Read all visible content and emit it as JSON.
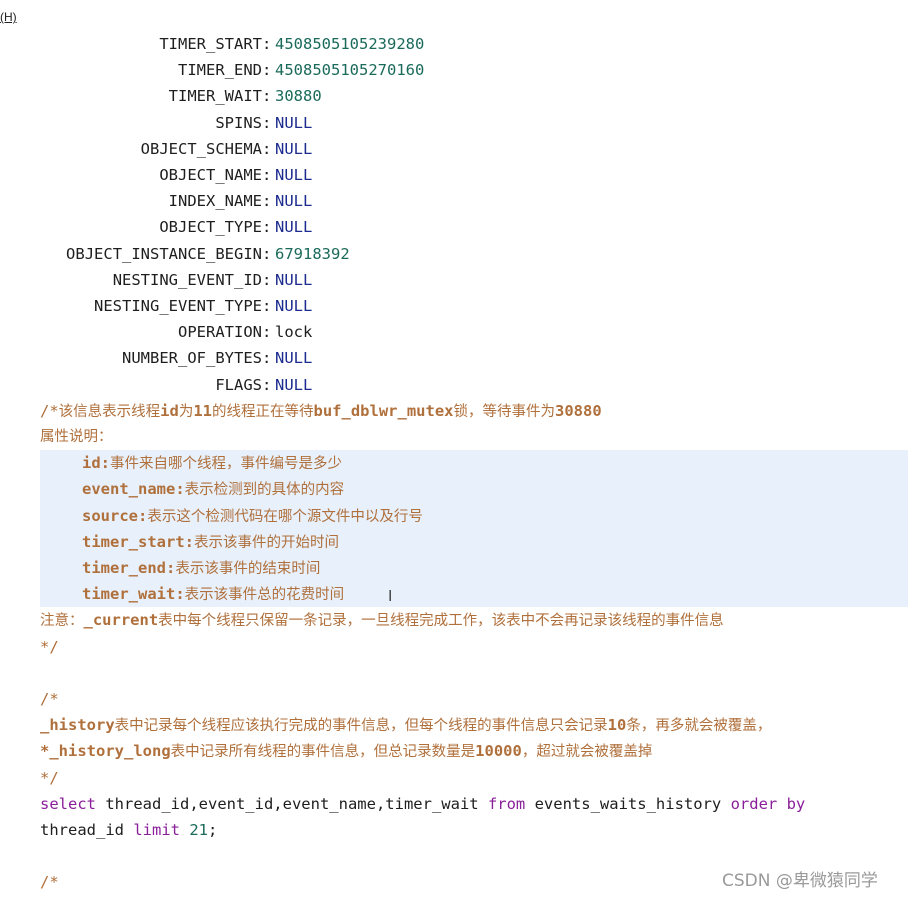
{
  "corner_label": "(H)",
  "record": {
    "rows": [
      {
        "key": "TIMER_START",
        "value": "4508505105239280",
        "type": "num"
      },
      {
        "key": "TIMER_END",
        "value": "4508505105270160",
        "type": "num"
      },
      {
        "key": "TIMER_WAIT",
        "value": "30880",
        "type": "num"
      },
      {
        "key": "SPINS",
        "value": "NULL",
        "type": "null"
      },
      {
        "key": "OBJECT_SCHEMA",
        "value": "NULL",
        "type": "null"
      },
      {
        "key": "OBJECT_NAME",
        "value": "NULL",
        "type": "null"
      },
      {
        "key": "INDEX_NAME",
        "value": "NULL",
        "type": "null"
      },
      {
        "key": "OBJECT_TYPE",
        "value": "NULL",
        "type": "null"
      },
      {
        "key": "OBJECT_INSTANCE_BEGIN",
        "value": "67918392",
        "type": "num"
      },
      {
        "key": "NESTING_EVENT_ID",
        "value": "NULL",
        "type": "null"
      },
      {
        "key": "NESTING_EVENT_TYPE",
        "value": "NULL",
        "type": "null"
      },
      {
        "key": "OPERATION",
        "value": "lock",
        "type": "plain"
      },
      {
        "key": "NUMBER_OF_BYTES",
        "value": "NULL",
        "type": "null"
      },
      {
        "key": "FLAGS",
        "value": "NULL",
        "type": "null"
      }
    ]
  },
  "comment1": {
    "line1": [
      {
        "t": "/*",
        "c": "cm"
      },
      {
        "t": "该信息表示线程",
        "c": "cz"
      },
      {
        "t": "id",
        "c": "cmb"
      },
      {
        "t": "为",
        "c": "cz"
      },
      {
        "t": "11",
        "c": "cmb"
      },
      {
        "t": "的线程正在等待",
        "c": "cz"
      },
      {
        "t": "buf_dblwr_mutex",
        "c": "cmb"
      },
      {
        "t": "锁，等待事件为",
        "c": "cz"
      },
      {
        "t": "30880",
        "c": "cmb"
      }
    ],
    "line2": "属性说明：",
    "props": [
      {
        "name": "id",
        "desc": "事件来自哪个线程，事件编号是多少"
      },
      {
        "name": "event_name",
        "desc": "表示检测到的具体的内容"
      },
      {
        "name": "source",
        "desc": "表示这个检测代码在哪个源文件中以及行号"
      },
      {
        "name": "timer_start",
        "desc": "表示该事件的开始时间"
      },
      {
        "name": "timer_end",
        "desc": "表示该事件的结束时间"
      },
      {
        "name": "timer_wait",
        "desc": "表示该事件总的花费时间"
      }
    ],
    "note": [
      {
        "t": "注意：",
        "c": "cz"
      },
      {
        "t": "_current",
        "c": "cmb"
      },
      {
        "t": "表中每个线程只保留一条记录，一旦线程完成工作，该表中不会再记录该线程的事件信息",
        "c": "cz"
      }
    ],
    "close": "*/"
  },
  "comment2": {
    "open": "/*",
    "line1": [
      {
        "t": "_history",
        "c": "cmb"
      },
      {
        "t": "表中记录每个线程应该执行完成的事件信息，但每个线程的事件信息只会记录",
        "c": "cz"
      },
      {
        "t": "10",
        "c": "cmb"
      },
      {
        "t": "条，再多就会被覆盖，",
        "c": "cz"
      }
    ],
    "line2": [
      {
        "t": "*_history_long",
        "c": "cmb"
      },
      {
        "t": "表中记录所有线程的事件信息，但总记录数量是",
        "c": "cz"
      },
      {
        "t": "10000",
        "c": "cmb"
      },
      {
        "t": "，超过就会被覆盖掉",
        "c": "cz"
      }
    ],
    "close": "*/"
  },
  "sql": {
    "line1": [
      {
        "t": "select",
        "c": "kw"
      },
      {
        "t": " thread_id,event_id,event_name,timer_wait ",
        "c": "id"
      },
      {
        "t": "from",
        "c": "kw"
      },
      {
        "t": " events_waits_history ",
        "c": "id"
      },
      {
        "t": "order by",
        "c": "kw"
      }
    ],
    "line2": [
      {
        "t": "thread_id ",
        "c": "id"
      },
      {
        "t": "limit",
        "c": "kw"
      },
      {
        "t": " ",
        "c": "id"
      },
      {
        "t": "21",
        "c": "nm"
      },
      {
        "t": ";",
        "c": "id"
      }
    ]
  },
  "comment3_open": "/*",
  "cursor_glyph": "I",
  "watermark": "CSDN @卑微猿同学"
}
